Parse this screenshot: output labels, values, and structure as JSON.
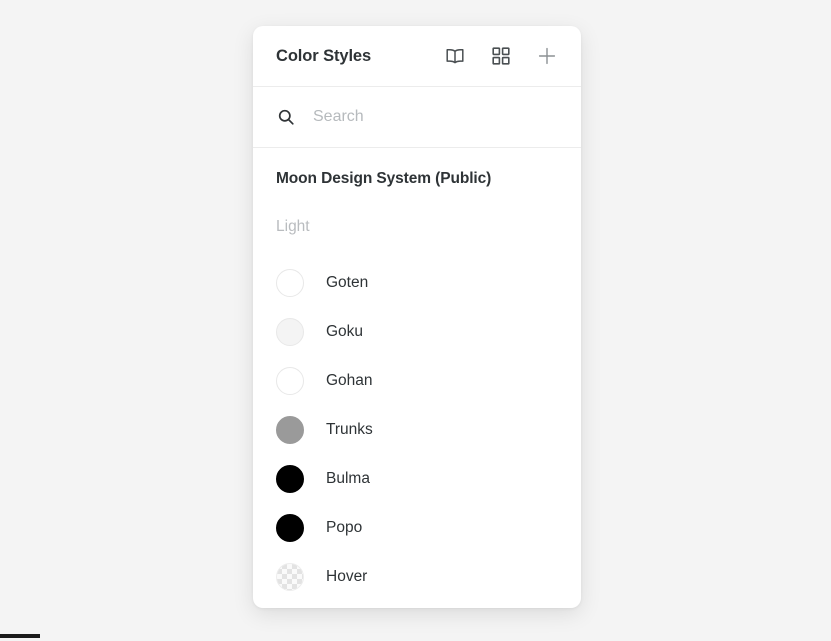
{
  "theme": {
    "page_background": "#f4f4f4",
    "panel_background": "#ffffff",
    "text_primary": "#2e3336",
    "text_muted": "#b9bcbf"
  },
  "panel": {
    "title": "Color Styles",
    "actions": [
      {
        "name": "library-book-icon",
        "label": "Libraries"
      },
      {
        "name": "grid-view-icon",
        "label": "Grid view"
      },
      {
        "name": "plus-icon",
        "label": "Create style"
      }
    ]
  },
  "search": {
    "placeholder": "Search",
    "value": "",
    "icon": "search-icon"
  },
  "library": {
    "name": "Moon Design System (Public)",
    "group_label": "Light"
  },
  "styles": [
    {
      "name": "Goten",
      "color": "#ffffff",
      "border": "#e8e8e8",
      "transparent": false
    },
    {
      "name": "Goku",
      "color": "#f4f4f4",
      "border": "#e8e8e8",
      "transparent": false
    },
    {
      "name": "Gohan",
      "color": "#ffffff",
      "border": "#e8e8e8",
      "transparent": false
    },
    {
      "name": "Trunks",
      "color": "#9a9a9a",
      "border": "#9a9a9a",
      "transparent": false
    },
    {
      "name": "Bulma",
      "color": "#000000",
      "border": "#000000",
      "transparent": false
    },
    {
      "name": "Popo",
      "color": "#000000",
      "border": "#000000",
      "transparent": false
    },
    {
      "name": "Hover",
      "color": "#fafafa",
      "border": "#ededed",
      "transparent": true
    }
  ]
}
